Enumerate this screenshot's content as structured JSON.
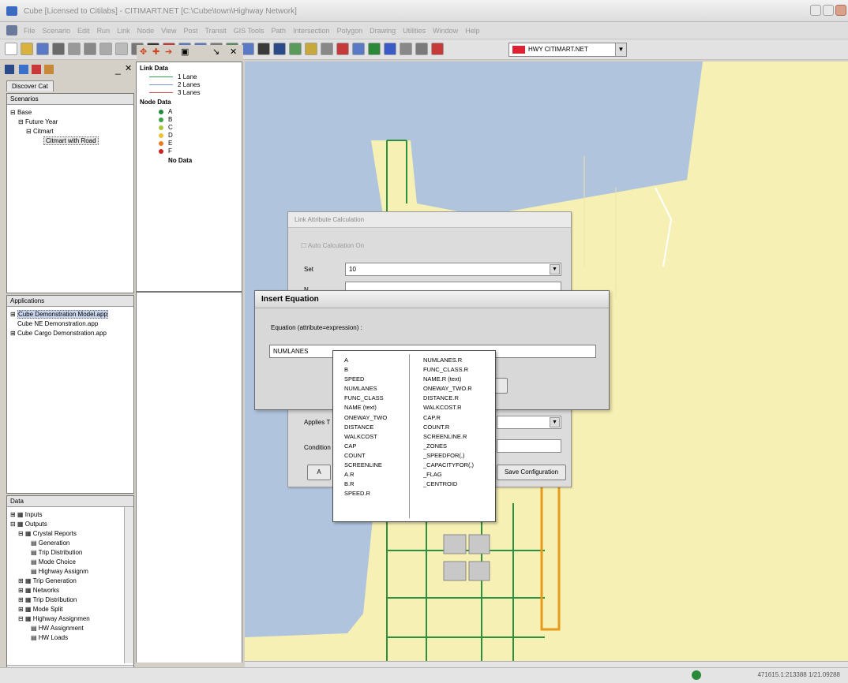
{
  "window": {
    "title": "Cube [Licensed to Citilabs] - CITIMART.NET [C:\\Cube\\town\\Highway Network]"
  },
  "menu": [
    "File",
    "Scenario",
    "Edit",
    "Run",
    "Link",
    "Node",
    "View",
    "Post",
    "Transit",
    "GIS Tools",
    "Path",
    "Intersection",
    "Polygon",
    "Drawing",
    "Utilities",
    "Window",
    "Help"
  ],
  "toolbar": {
    "layer_combo": "HWY CITIMART.NET"
  },
  "left": {
    "tab": "Discover Cat",
    "scenarios_head": "Scenarios",
    "scenarios": [
      "Base",
      "Future Year",
      "Citmart",
      "Citmart with Road"
    ],
    "applications_head": "Applications",
    "applications": [
      "Cube Demonstration Model.app",
      "Cube NE Demonstration.app",
      "Cube Cargo Demonstration.app"
    ],
    "data_head": "Data",
    "data": [
      "Inputs",
      "Outputs",
      "Crystal Reports",
      "Generation",
      "Trip Distribution",
      "Mode Choice",
      "Highway Assignm",
      "Trip Generation",
      "Networks",
      "Trip Distribution",
      "Mode Split",
      "Highway Assignmen",
      "HW Assignment",
      "HW Loads"
    ]
  },
  "legend": {
    "link_title": "Link Data",
    "links": [
      {
        "label": "1 Lane",
        "color": "#2e9e4f"
      },
      {
        "label": "2 Lanes",
        "color": "#7e93c4"
      },
      {
        "label": "3 Lanes",
        "color": "#d24d4d"
      }
    ],
    "node_title": "Node Data",
    "nodes": [
      {
        "label": "A",
        "color": "#1e8a3a"
      },
      {
        "label": "B",
        "color": "#3aa24a"
      },
      {
        "label": "C",
        "color": "#a6c83a"
      },
      {
        "label": "D",
        "color": "#f0c030"
      },
      {
        "label": "E",
        "color": "#f07a20"
      },
      {
        "label": "F",
        "color": "#d0201a"
      }
    ],
    "nodata": "No Data"
  },
  "link_calc": {
    "title": "Link Attribute Calculation",
    "auto_calc": "Auto Calculation On",
    "set_label": "Set",
    "set_value": "10",
    "name_label": "N",
    "applies_label": "Applies T",
    "condition_label": "Condition",
    "apply_label": "A",
    "save_label": "Save Configuration"
  },
  "insert_eq": {
    "title": "Insert Equation",
    "label": "Equation (attribute=expression) :",
    "value": "NUMLANES"
  },
  "attrs": {
    "col1": [
      "A",
      "B",
      "SPEED",
      "NUMLANES",
      "FUNC_CLASS",
      "NAME (text)",
      "ONEWAY_TWO",
      "DISTANCE",
      "WALKCOST",
      "CAP",
      "COUNT",
      "SCREENLINE",
      "A.R",
      "B.R",
      "SPEED.R"
    ],
    "col2": [
      "NUMLANES.R",
      "FUNC_CLASS.R",
      "NAME.R (text)",
      "ONEWAY_TWO.R",
      "DISTANCE.R",
      "WALKCOST.R",
      "CAP.R",
      "COUNT.R",
      "SCREENLINE.R",
      "_ZONES",
      "_SPEEDFOR(,)",
      "_CAPACITYFOR(,)",
      "_FLAG",
      "_CENTROID"
    ]
  },
  "status": {
    "coords": "471615.1:213388 1/21.09288"
  },
  "colors": {
    "water": "#b0c4de",
    "land": "#f7f0b4",
    "road": "#2e8f3e",
    "arterial": "#e59a1c"
  }
}
